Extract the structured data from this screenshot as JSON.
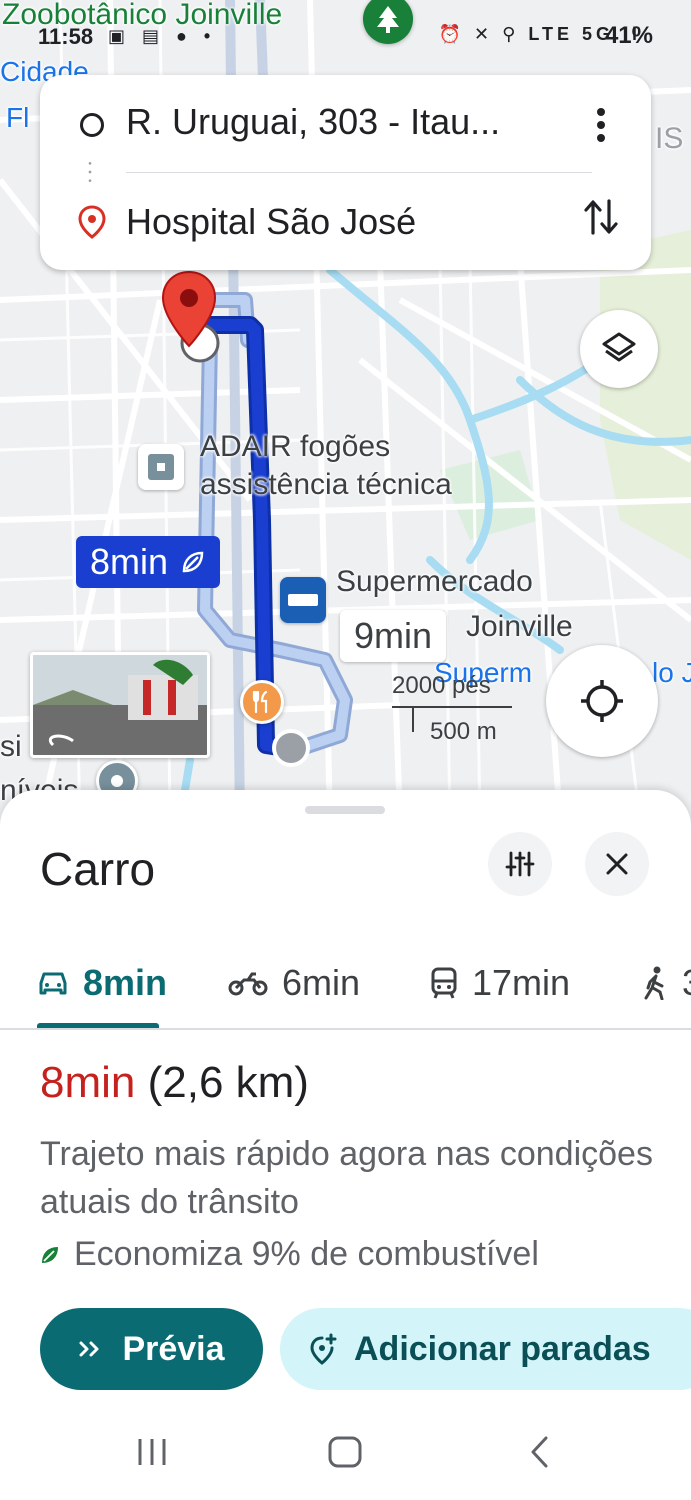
{
  "status_bar": {
    "time": "11:58",
    "battery": "41%"
  },
  "map": {
    "labels": {
      "park": "Zoobotânico Joinville",
      "cidade": "Cidade",
      "fl": "Fl",
      "poi_adair_line1": "ADAIR fogões",
      "poi_adair_line2": "assistência técnica",
      "supermercado_line1": "Supermercado",
      "supermercado_line2": "Joinville",
      "supermercado_blue": "Superm",
      "supermercado_blue_tail": "lo J",
      "left_si": "si",
      "left_niveis": "níveis",
      "right_is": "IS"
    },
    "route_primary_label": "8min",
    "route_alt_label": "9min",
    "scale": {
      "feet": "2000 pés",
      "meters": "500 m"
    }
  },
  "search": {
    "origin": "R. Uruguai, 303 - Itau...",
    "destination": "Hospital São José"
  },
  "sheet": {
    "title": "Carro",
    "tabs": [
      {
        "label": "8min",
        "icon": "car-icon"
      },
      {
        "label": "6min",
        "icon": "motorcycle-icon"
      },
      {
        "label": "17min",
        "icon": "transit-icon"
      },
      {
        "label": "3",
        "icon": "walk-icon"
      }
    ],
    "summary_duration": "8min",
    "summary_distance": "(2,6 km)",
    "description": "Trajeto mais rápido agora nas condições atuais do trânsito",
    "eco_text": "Economiza 9% de combustível",
    "preview_button": "Prévia",
    "add_stops_button": "Adicionar paradas"
  },
  "colors": {
    "route_primary": "#1a3fd0",
    "accent_teal": "#0a6b73",
    "duration_red": "#c5221f",
    "eco_green": "#188038"
  }
}
